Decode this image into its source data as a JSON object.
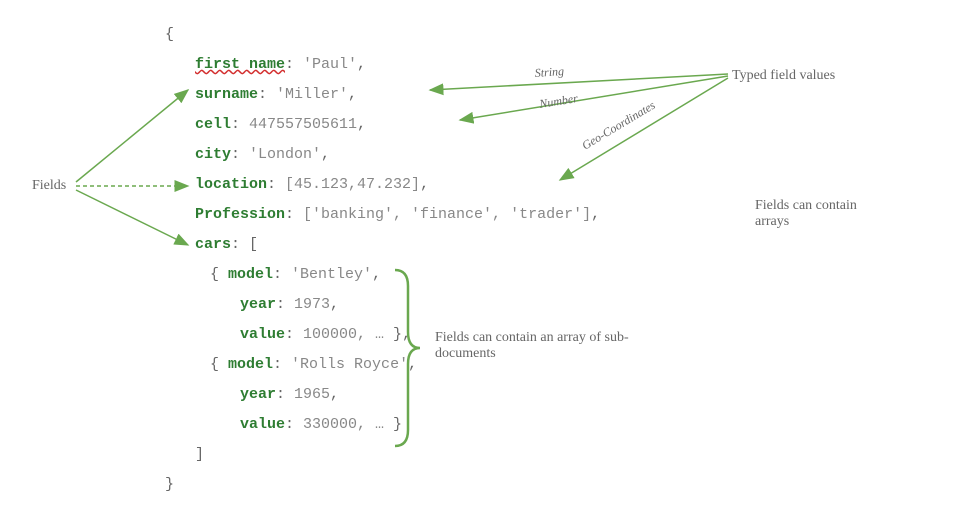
{
  "labels": {
    "fields": "Fields",
    "typed_values": "Typed field values",
    "arrays_note": "Fields can contain arrays",
    "subdoc_note": "Fields can contain an array of sub-documents",
    "type_string": "String",
    "type_number": "Number",
    "type_geo": "Geo-Coordinates"
  },
  "doc": {
    "open_brace": "{",
    "close_brace": "}",
    "close_bracket": "]",
    "first_name_key": "first name",
    "first_name_val": "'Paul'",
    "surname_key": "surname",
    "surname_val": "'Miller'",
    "cell_key": "cell",
    "cell_val": "447557505611",
    "city_key": "city",
    "city_val": "'London'",
    "location_key": "location",
    "location_val": "[45.123,47.232]",
    "profession_key": "Profession",
    "profession_val": "['banking', 'finance', 'trader']",
    "cars_key": "cars",
    "cars_open": "[",
    "car1_model_key": "model",
    "car1_model_val": "'Bentley'",
    "car1_year_key": "year",
    "car1_year_val": "1973",
    "car1_value_key": "value",
    "car1_value_val": "100000, …",
    "car2_model_key": "model",
    "car2_model_val": "'Rolls Royce'",
    "car2_year_key": "year",
    "car2_year_val": "1965",
    "car2_value_key": "value",
    "car2_value_val": "330000, …",
    "colon": ": ",
    "comma": ",",
    "obj_open": "{ ",
    "obj_close": " }"
  }
}
